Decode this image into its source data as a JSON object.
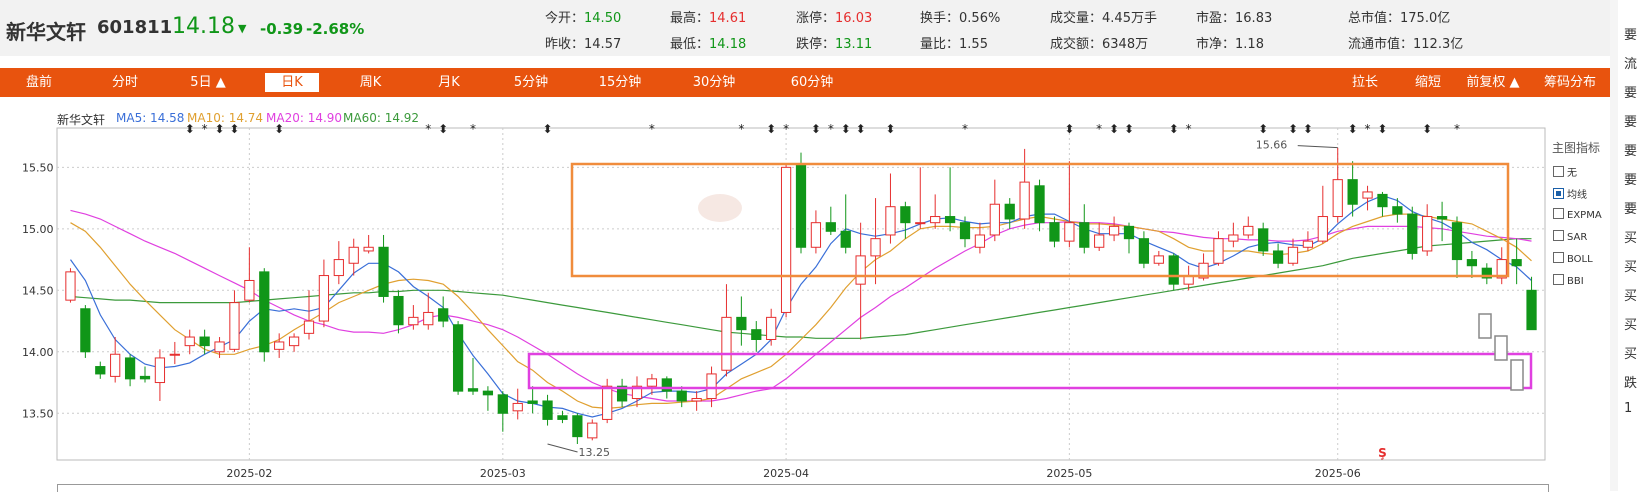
{
  "stock": {
    "name": "新华文轩",
    "code": "601811",
    "price": "14.18",
    "arrow": "▼",
    "change": "-0.39",
    "change_pct": "-2.68%"
  },
  "stats": [
    {
      "label": "今开：",
      "value": "14.50",
      "tone": "dn"
    },
    {
      "label": "最高：",
      "value": "14.61",
      "tone": "up"
    },
    {
      "label": "涨停：",
      "value": "16.03",
      "tone": "up"
    },
    {
      "label": "换手：",
      "value": "0.56%",
      "tone": "v"
    },
    {
      "label": "成交量：",
      "value": "4.45万手",
      "tone": "v"
    },
    {
      "label": "市盈：",
      "value": "16.83",
      "tone": "v"
    },
    {
      "label": "总市值：",
      "value": "175.0亿",
      "tone": "v"
    },
    {
      "label": "昨收：",
      "value": "14.57",
      "tone": "v"
    },
    {
      "label": "最低：",
      "value": "14.18",
      "tone": "dn"
    },
    {
      "label": "跌停：",
      "value": "13.11",
      "tone": "dn"
    },
    {
      "label": "量比：",
      "value": "1.55",
      "tone": "v"
    },
    {
      "label": "成交额：",
      "value": "6348万",
      "tone": "v"
    },
    {
      "label": "市净：",
      "value": "1.18",
      "tone": "v"
    },
    {
      "label": "流通市值：",
      "value": "112.3亿",
      "tone": "v"
    }
  ],
  "tabs": [
    "盘前",
    "分时",
    "5日 ▲",
    "日K",
    "周K",
    "月K",
    "5分钟",
    "15分钟",
    "30分钟",
    "60分钟"
  ],
  "active_tab": "日K",
  "right_tabs": [
    "拉长",
    "缩短",
    "前复权 ▲",
    "筹码分布"
  ],
  "right_strip_chars": [
    "要",
    "流",
    "要",
    "要",
    "要",
    "要",
    "要",
    "买",
    "买",
    "买",
    "买",
    "买",
    "跌",
    "1"
  ],
  "indicator_panel": {
    "title": "主图指标",
    "items": [
      {
        "label": "无",
        "checked": false
      },
      {
        "label": "均线",
        "checked": true
      },
      {
        "label": "EXPMA",
        "checked": false
      },
      {
        "label": "SAR",
        "checked": false
      },
      {
        "label": "BOLL",
        "checked": false
      },
      {
        "label": "BBI",
        "checked": false
      }
    ]
  },
  "colors": {
    "up": "#e62e2e",
    "down": "#109618",
    "ma5": "#3a6fd8",
    "ma10": "#e0a030",
    "ma20": "#e040e0",
    "ma60": "#3c9a3c",
    "orange_box": "#f08c3c",
    "magenta_box": "#e040e0",
    "tabbar": "#e8530e"
  },
  "chart_data": {
    "type": "candlestick",
    "title": "新华文轩",
    "ma_legend": [
      {
        "name": "MA5",
        "value": "14.58"
      },
      {
        "name": "MA10",
        "value": "14.74"
      },
      {
        "name": "MA20",
        "value": "14.90"
      },
      {
        "name": "MA60",
        "value": "14.92"
      }
    ],
    "y_ticks": [
      "15.50",
      "15.00",
      "14.50",
      "14.00",
      "13.50"
    ],
    "y_tick_values": [
      15.5,
      15.0,
      14.5,
      14.0,
      13.5
    ],
    "ylim": [
      13.12,
      15.82
    ],
    "x_ticks": [
      {
        "label": "2025-02",
        "index": 12
      },
      {
        "label": "2025-03",
        "index": 29
      },
      {
        "label": "2025-04",
        "index": 48
      },
      {
        "label": "2025-05",
        "index": 67
      },
      {
        "label": "2025-06",
        "index": 85
      }
    ],
    "high_label": "15.66",
    "low_label": "13.25",
    "high_index": 85,
    "low_index": 32,
    "candles": [
      [
        14.42,
        14.65,
        14.68,
        14.4
      ],
      [
        14.35,
        14.0,
        14.38,
        13.95
      ],
      [
        13.88,
        13.82,
        13.92,
        13.78
      ],
      [
        13.8,
        13.98,
        14.12,
        13.75
      ],
      [
        13.95,
        13.78,
        13.98,
        13.72
      ],
      [
        13.8,
        13.78,
        13.88,
        13.75
      ],
      [
        13.75,
        13.95,
        14.02,
        13.6
      ],
      [
        13.98,
        13.98,
        14.08,
        13.9
      ],
      [
        14.05,
        14.12,
        14.18,
        13.98
      ],
      [
        14.12,
        14.05,
        14.18,
        13.98
      ],
      [
        14.0,
        14.08,
        14.12,
        13.95
      ],
      [
        14.02,
        14.4,
        14.5,
        14.0
      ],
      [
        14.42,
        14.58,
        14.85,
        14.4
      ],
      [
        14.65,
        14.0,
        14.68,
        13.92
      ],
      [
        14.02,
        14.08,
        14.15,
        13.95
      ],
      [
        14.05,
        14.12,
        14.15,
        14.0
      ],
      [
        14.15,
        14.25,
        14.5,
        14.1
      ],
      [
        14.25,
        14.62,
        14.75,
        14.2
      ],
      [
        14.62,
        14.75,
        14.9,
        14.55
      ],
      [
        14.72,
        14.85,
        14.92,
        14.62
      ],
      [
        14.82,
        14.85,
        14.95,
        14.8
      ],
      [
        14.85,
        14.45,
        14.95,
        14.4
      ],
      [
        14.45,
        14.22,
        14.5,
        14.15
      ],
      [
        14.22,
        14.28,
        14.38,
        14.18
      ],
      [
        14.22,
        14.32,
        14.48,
        14.18
      ],
      [
        14.35,
        14.25,
        14.45,
        14.2
      ],
      [
        14.22,
        13.68,
        14.25,
        13.65
      ],
      [
        13.7,
        13.68,
        13.95,
        13.65
      ],
      [
        13.68,
        13.65,
        13.72,
        13.52
      ],
      [
        13.65,
        13.5,
        13.68,
        13.35
      ],
      [
        13.52,
        13.58,
        13.7,
        13.45
      ],
      [
        13.6,
        13.58,
        13.72,
        13.5
      ],
      [
        13.6,
        13.45,
        13.65,
        13.4
      ],
      [
        13.48,
        13.45,
        13.52,
        13.42
      ],
      [
        13.48,
        13.31,
        13.5,
        13.25
      ],
      [
        13.3,
        13.42,
        13.45,
        13.28
      ],
      [
        13.45,
        13.72,
        13.78,
        13.42
      ],
      [
        13.72,
        13.6,
        13.78,
        13.55
      ],
      [
        13.62,
        13.72,
        13.8,
        13.55
      ],
      [
        13.72,
        13.78,
        13.82,
        13.65
      ],
      [
        13.78,
        13.68,
        13.8,
        13.62
      ],
      [
        13.68,
        13.6,
        13.72,
        13.55
      ],
      [
        13.6,
        13.62,
        13.68,
        13.52
      ],
      [
        13.62,
        13.82,
        13.88,
        13.55
      ],
      [
        13.85,
        14.28,
        14.55,
        13.8
      ],
      [
        14.28,
        14.18,
        14.45,
        14.05
      ],
      [
        14.18,
        14.1,
        14.25,
        14.0
      ],
      [
        14.1,
        14.28,
        14.35,
        14.05
      ],
      [
        14.32,
        15.5,
        15.52,
        14.28
      ],
      [
        15.52,
        14.85,
        15.62,
        14.8
      ],
      [
        14.85,
        15.05,
        15.15,
        14.8
      ],
      [
        15.05,
        14.98,
        15.18,
        14.95
      ],
      [
        14.98,
        14.85,
        15.28,
        14.8
      ],
      [
        14.55,
        14.78,
        15.05,
        14.1
      ],
      [
        14.78,
        14.92,
        15.25,
        14.55
      ],
      [
        14.95,
        15.18,
        15.45,
        14.88
      ],
      [
        15.18,
        15.05,
        15.22,
        14.92
      ],
      [
        15.05,
        15.05,
        15.5,
        15.0
      ],
      [
        15.05,
        15.1,
        15.28,
        15.0
      ],
      [
        15.1,
        15.05,
        15.5,
        14.98
      ],
      [
        15.05,
        14.92,
        15.1,
        14.85
      ],
      [
        14.85,
        14.95,
        15.05,
        14.8
      ],
      [
        14.95,
        15.2,
        15.4,
        14.9
      ],
      [
        15.2,
        15.08,
        15.25,
        15.0
      ],
      [
        15.08,
        15.38,
        15.65,
        15.0
      ],
      [
        15.35,
        15.05,
        15.4,
        14.98
      ],
      [
        15.05,
        14.9,
        15.1,
        14.85
      ],
      [
        14.9,
        15.05,
        15.55,
        14.85
      ],
      [
        15.05,
        14.85,
        15.2,
        14.8
      ],
      [
        14.85,
        14.95,
        15.05,
        14.82
      ],
      [
        14.95,
        15.02,
        15.1,
        14.9
      ],
      [
        15.02,
        14.92,
        15.05,
        14.8
      ],
      [
        14.92,
        14.72,
        14.98,
        14.68
      ],
      [
        14.72,
        14.78,
        14.82,
        14.7
      ],
      [
        14.78,
        14.55,
        14.8,
        14.5
      ],
      [
        14.55,
        14.62,
        14.7,
        14.5
      ],
      [
        14.6,
        14.72,
        14.8,
        14.58
      ],
      [
        14.72,
        14.92,
        14.98,
        14.7
      ],
      [
        14.9,
        14.95,
        15.05,
        14.85
      ],
      [
        14.95,
        15.02,
        15.1,
        14.92
      ],
      [
        15.0,
        14.82,
        15.05,
        14.78
      ],
      [
        14.82,
        14.72,
        14.88,
        14.68
      ],
      [
        14.72,
        14.85,
        14.92,
        14.7
      ],
      [
        14.85,
        14.9,
        14.98,
        14.82
      ],
      [
        14.9,
        15.1,
        15.35,
        14.88
      ],
      [
        15.1,
        15.4,
        15.66,
        15.05
      ],
      [
        15.4,
        15.2,
        15.55,
        15.1
      ],
      [
        15.25,
        15.3,
        15.35,
        15.15
      ],
      [
        15.28,
        15.18,
        15.3,
        15.1
      ],
      [
        15.18,
        15.12,
        15.25,
        15.05
      ],
      [
        15.12,
        14.8,
        15.18,
        14.75
      ],
      [
        14.82,
        15.1,
        15.2,
        14.78
      ],
      [
        15.1,
        15.08,
        15.22,
        14.9
      ],
      [
        15.05,
        14.75,
        15.1,
        14.6
      ],
      [
        14.75,
        14.7,
        14.82,
        14.6
      ],
      [
        14.68,
        14.6,
        14.72,
        14.55
      ],
      [
        14.6,
        14.75,
        14.85,
        14.55
      ],
      [
        14.75,
        14.7,
        14.92,
        14.55
      ],
      [
        14.5,
        14.18,
        14.61,
        14.18
      ]
    ],
    "ma5": [
      14.75,
      14.58,
      14.3,
      14.1,
      13.98,
      13.9,
      13.87,
      13.88,
      13.91,
      13.98,
      14.04,
      14.1,
      14.25,
      14.35,
      14.33,
      14.35,
      14.33,
      14.36,
      14.5,
      14.64,
      14.72,
      14.72,
      14.65,
      14.53,
      14.45,
      14.36,
      14.15,
      13.97,
      13.82,
      13.66,
      13.6,
      13.58,
      13.55,
      13.54,
      13.5,
      13.47,
      13.5,
      13.54,
      13.6,
      13.67,
      13.68,
      13.68,
      13.67,
      13.7,
      13.82,
      13.9,
      13.98,
      14.1,
      14.35,
      14.55,
      14.69,
      14.88,
      15.0,
      14.96,
      14.94,
      14.96,
      14.99,
      15.04,
      15.08,
      15.09,
      15.06,
      15.04,
      15.05,
      15.05,
      15.1,
      15.12,
      15.12,
      15.06,
      15.0,
      14.96,
      14.96,
      14.96,
      14.9,
      14.85,
      14.8,
      14.72,
      14.68,
      14.72,
      14.78,
      14.85,
      14.88,
      14.89,
      14.87,
      14.86,
      14.92,
      15.04,
      15.14,
      15.22,
      15.27,
      15.23,
      15.14,
      15.09,
      15.05,
      14.98,
      14.89,
      14.83,
      14.75,
      14.69,
      14.58
    ],
    "ma10": [
      15.05,
      14.98,
      14.85,
      14.7,
      14.55,
      14.42,
      14.3,
      14.18,
      14.1,
      14.02,
      13.98,
      13.98,
      14.02,
      14.05,
      14.1,
      14.18,
      14.25,
      14.32,
      14.4,
      14.45,
      14.5,
      14.55,
      14.58,
      14.59,
      14.58,
      14.55,
      14.45,
      14.32,
      14.18,
      14.05,
      13.92,
      13.85,
      13.75,
      13.68,
      13.6,
      13.55,
      13.54,
      13.55,
      13.57,
      13.58,
      13.58,
      13.59,
      13.6,
      13.62,
      13.7,
      13.78,
      13.83,
      13.88,
      13.98,
      14.1,
      14.22,
      14.36,
      14.52,
      14.65,
      14.75,
      14.82,
      14.92,
      15.0,
      15.02,
      15.02,
      15.01,
      15.01,
      15.02,
      15.05,
      15.08,
      15.1,
      15.08,
      15.06,
      15.04,
      15.04,
      15.03,
      15.02,
      15.0,
      14.98,
      14.92,
      14.85,
      14.82,
      14.82,
      14.82,
      14.82,
      14.8,
      14.79,
      14.8,
      14.82,
      14.88,
      14.96,
      15.02,
      15.06,
      15.1,
      15.12,
      15.12,
      15.1,
      15.08,
      15.06,
      15.04,
      14.98,
      14.92,
      14.85,
      14.74
    ],
    "ma20": [
      15.15,
      15.12,
      15.08,
      15.02,
      14.96,
      14.9,
      14.85,
      14.8,
      14.74,
      14.68,
      14.62,
      14.56,
      14.5,
      14.42,
      14.36,
      14.3,
      14.25,
      14.22,
      14.18,
      14.16,
      14.16,
      14.15,
      14.18,
      14.22,
      14.28,
      14.3,
      14.28,
      14.25,
      14.22,
      14.18,
      14.12,
      14.05,
      13.98,
      13.9,
      13.82,
      13.75,
      13.7,
      13.66,
      13.64,
      13.62,
      13.6,
      13.6,
      13.6,
      13.6,
      13.62,
      13.65,
      13.68,
      13.7,
      13.78,
      13.88,
      13.98,
      14.08,
      14.18,
      14.28,
      14.36,
      14.45,
      14.52,
      14.6,
      14.68,
      14.75,
      14.82,
      14.88,
      14.95,
      15.0,
      15.03,
      15.05,
      15.05,
      15.06,
      15.05,
      15.05,
      15.04,
      15.02,
      15.0,
      14.98,
      14.97,
      14.95,
      14.93,
      14.92,
      14.92,
      14.91,
      14.91,
      14.9,
      14.9,
      14.91,
      14.94,
      14.98,
      15.0,
      15.02,
      15.02,
      15.02,
      15.02,
      15.01,
      15.0,
      14.98,
      14.96,
      14.94,
      14.93,
      14.92,
      14.9
    ],
    "ma60": [
      14.45,
      14.44,
      14.43,
      14.42,
      14.42,
      14.41,
      14.4,
      14.4,
      14.4,
      14.4,
      14.4,
      14.4,
      14.41,
      14.42,
      14.43,
      14.44,
      14.45,
      14.46,
      14.47,
      14.48,
      14.48,
      14.49,
      14.49,
      14.5,
      14.5,
      14.5,
      14.49,
      14.48,
      14.47,
      14.46,
      14.44,
      14.42,
      14.4,
      14.38,
      14.36,
      14.34,
      14.32,
      14.3,
      14.28,
      14.26,
      14.24,
      14.22,
      14.2,
      14.18,
      14.16,
      14.15,
      14.14,
      14.13,
      14.12,
      14.12,
      14.11,
      14.11,
      14.11,
      14.11,
      14.12,
      14.13,
      14.14,
      14.16,
      14.18,
      14.2,
      14.22,
      14.24,
      14.26,
      14.28,
      14.3,
      14.32,
      14.34,
      14.36,
      14.38,
      14.4,
      14.42,
      14.44,
      14.46,
      14.48,
      14.5,
      14.52,
      14.54,
      14.56,
      14.58,
      14.6,
      14.62,
      14.64,
      14.66,
      14.68,
      14.7,
      14.73,
      14.76,
      14.78,
      14.8,
      14.82,
      14.84,
      14.86,
      14.87,
      14.88,
      14.89,
      14.9,
      14.91,
      14.92,
      14.92
    ]
  }
}
